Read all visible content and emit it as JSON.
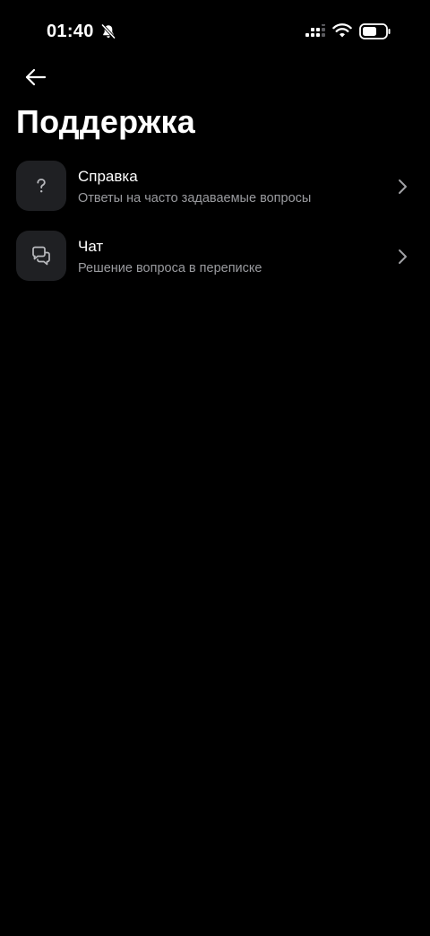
{
  "status_bar": {
    "time": "01:40",
    "bell_icon": "bell-muted-icon",
    "signal_icon": "signal-icon",
    "wifi_icon": "wifi-icon",
    "battery_icon": "battery-icon"
  },
  "header": {
    "back_icon": "arrow-left-icon",
    "title": "Поддержка"
  },
  "menu": {
    "items": [
      {
        "icon": "question-icon",
        "title": "Справка",
        "subtitle": "Ответы на часто задаваемые вопросы"
      },
      {
        "icon": "chat-bubbles-icon",
        "title": "Чат",
        "subtitle": "Решение вопроса в переписке"
      }
    ]
  },
  "colors": {
    "background": "#000000",
    "icon_tile": "#1f2023",
    "text_primary": "#ffffff",
    "text_secondary": "#9a9b9f",
    "chevron": "#a0a1a5"
  }
}
